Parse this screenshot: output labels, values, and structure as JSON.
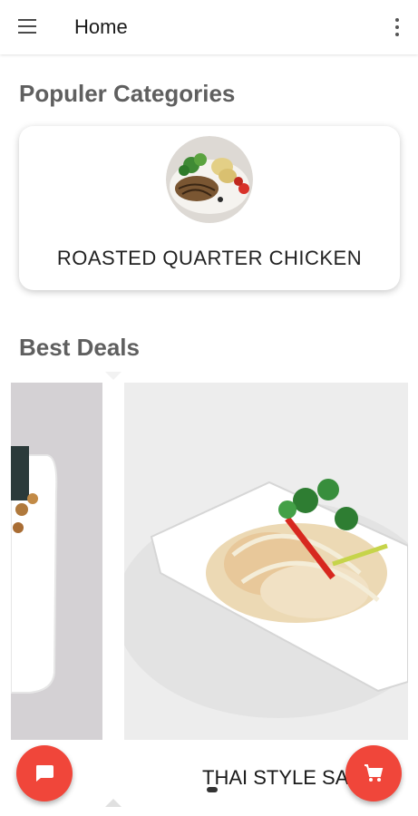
{
  "appbar": {
    "title": "Home",
    "menu_icon": "hamburger-menu-icon",
    "overflow_icon": "more-vert-icon"
  },
  "popular": {
    "heading": "Populer Categories",
    "items": [
      {
        "label": "ROASTED QUARTER CHICKEN"
      }
    ]
  },
  "best_deals": {
    "heading": "Best Deals",
    "slides": [
      {
        "caption": ""
      },
      {
        "caption": "THAI STYLE SALAD"
      }
    ],
    "active_page": 1
  },
  "fabs": {
    "chat_icon": "chat-icon",
    "cart_icon": "cart-icon"
  },
  "colors": {
    "accent": "#f0463a",
    "heading_text": "#5f5f5f"
  }
}
